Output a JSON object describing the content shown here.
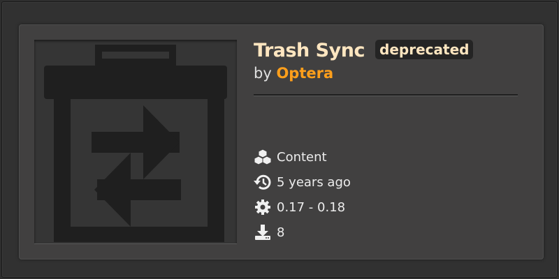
{
  "mod": {
    "title": "Trash Sync",
    "status_badge": "deprecated",
    "by_prefix": "by",
    "author": "Optera",
    "thumbnail_icon": "trash-sync-icon"
  },
  "meta": {
    "category": {
      "icon": "cubes-icon",
      "text": "Content"
    },
    "updated": {
      "icon": "history-icon",
      "text": "5 years ago"
    },
    "versions": {
      "icon": "gear-icon",
      "text": "0.17 - 0.18"
    },
    "downloads": {
      "icon": "download-icon",
      "text": "8"
    }
  },
  "colors": {
    "title": "#ffe6c0",
    "author": "#ff9f1b",
    "card_bg": "#414040",
    "badge_bg": "#242424"
  }
}
